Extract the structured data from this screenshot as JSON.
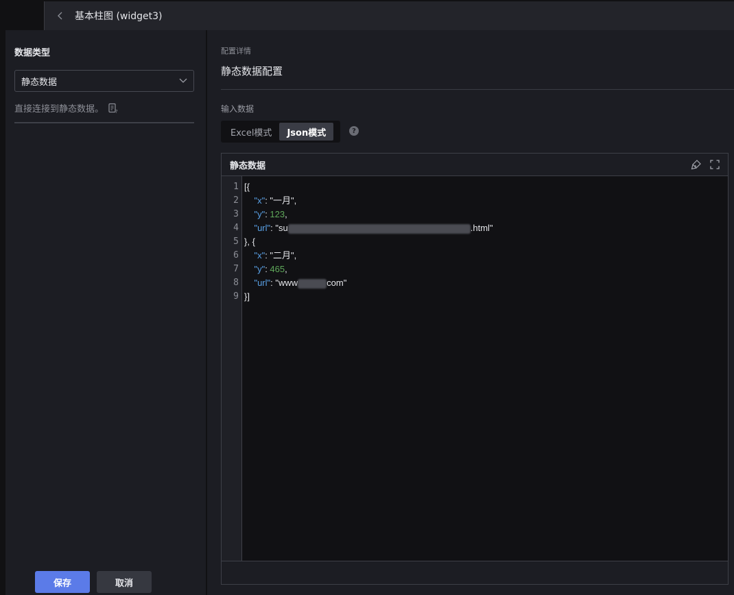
{
  "topbar": {
    "title": "基本柱图 (widget3)"
  },
  "left": {
    "section_label": "数据类型",
    "select_value": "静态数据",
    "hint": "直接连接到静态数据。",
    "save_label": "保存",
    "cancel_label": "取消"
  },
  "right": {
    "crumb": "配置详情",
    "title": "静态数据配置",
    "input_label": "输入数据",
    "modes": [
      "Excel模式",
      "Json模式"
    ],
    "editor_title": "静态数据",
    "line_numbers": [
      "1",
      "2",
      "3",
      "4",
      "5",
      "6",
      "7",
      "8",
      "9"
    ],
    "code": {
      "l1": "[{",
      "k1": "\"x\"",
      "v1": "\"一月\"",
      "k2": "\"y\"",
      "v2": "123",
      "k3": "\"url\"",
      "v3a": "\"su",
      "v3b": ".html\"",
      "l5": "}, {",
      "k4": "\"x\"",
      "v4": "\"二月\"",
      "k5": "\"y\"",
      "v5": "465",
      "k6": "\"url\"",
      "v6a": "\"www",
      "v6b": "com\"",
      "l9": "}]"
    }
  }
}
